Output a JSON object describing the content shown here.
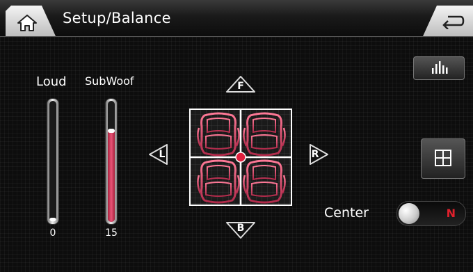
{
  "header": {
    "title": "Setup/Balance",
    "home_icon": "home-icon",
    "back_icon": "back-arrow-icon"
  },
  "sliders": [
    {
      "label": "Loud",
      "value": "0",
      "level": 0
    },
    {
      "label": "SubWoof",
      "value": "15",
      "level": 0.75
    }
  ],
  "balance": {
    "front_label": "F",
    "back_label": "B",
    "left_label": "L",
    "right_label": "R",
    "seat_icon": "car-seat-icon",
    "position_marker": "balance-marker"
  },
  "side_buttons": {
    "equalizer_icon": "equalizer-icon",
    "center_balance_icon": "center-balance-icon"
  },
  "center_toggle": {
    "label": "Center",
    "state": "N"
  },
  "colors": {
    "accent": "#e0202c",
    "seat_pink": "#e85478"
  }
}
